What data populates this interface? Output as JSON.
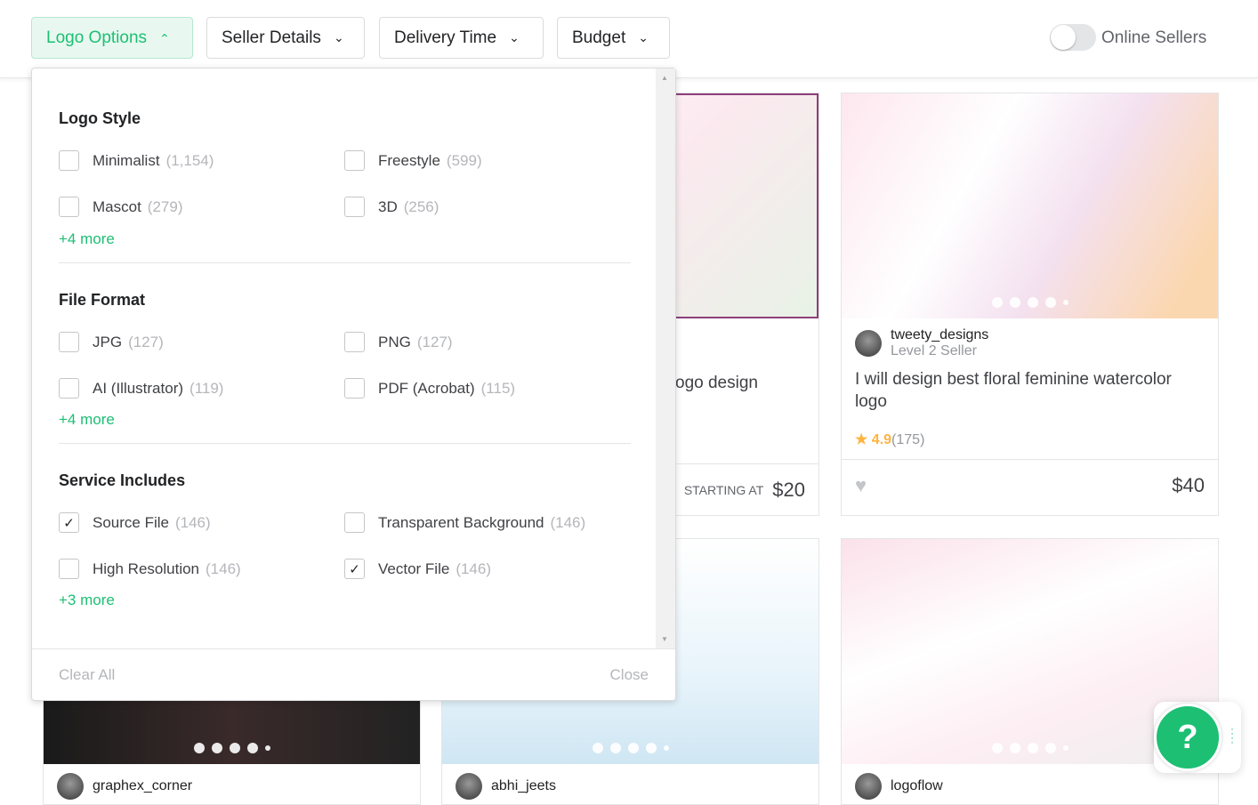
{
  "filters": [
    {
      "label": "Logo Options",
      "active": true
    },
    {
      "label": "Seller Details"
    },
    {
      "label": "Delivery Time"
    },
    {
      "label": "Budget"
    }
  ],
  "online_sellers": {
    "label": "Online Sellers",
    "on": false
  },
  "dropdown": {
    "sections": [
      {
        "title": "Logo Style",
        "options": [
          {
            "label": "Minimalist",
            "count": "(1,154)",
            "checked": false
          },
          {
            "label": "Freestyle",
            "count": "(599)",
            "checked": false
          },
          {
            "label": "Mascot",
            "count": "(279)",
            "checked": false
          },
          {
            "label": "3D",
            "count": "(256)",
            "checked": false
          }
        ],
        "more": "+4 more"
      },
      {
        "title": "File Format",
        "options": [
          {
            "label": "JPG",
            "count": "(127)",
            "checked": false
          },
          {
            "label": "PNG",
            "count": "(127)",
            "checked": false
          },
          {
            "label": "AI (Illustrator)",
            "count": "(119)",
            "checked": false
          },
          {
            "label": "PDF (Acrobat)",
            "count": "(115)",
            "checked": false
          }
        ],
        "more": "+4 more"
      },
      {
        "title": "Service Includes",
        "options": [
          {
            "label": "Source File",
            "count": "(146)",
            "checked": true
          },
          {
            "label": "Transparent Background",
            "count": "(146)",
            "checked": false
          },
          {
            "label": "High Resolution",
            "count": "(146)",
            "checked": false
          },
          {
            "label": "Vector File",
            "count": "(146)",
            "checked": true
          }
        ],
        "more": "+3 more"
      }
    ],
    "clear_all": "Clear All",
    "close": "Close"
  },
  "cards": [
    {
      "title_partial": "ogo design",
      "starting_at": "STARTING AT",
      "price": "$20"
    },
    {
      "seller": "tweety_designs",
      "level": "Level 2 Seller",
      "title": "I will design best floral feminine watercolor logo",
      "rating": "4.9",
      "reviews": "(175)",
      "price": "$40"
    },
    {
      "seller": "graphex_corner"
    },
    {
      "seller": "abhi_jeets"
    },
    {
      "seller": "logoflow"
    }
  ],
  "help": {
    "label": "?"
  },
  "colors": {
    "accent": "#1dbf73",
    "star": "#ffb33e"
  }
}
